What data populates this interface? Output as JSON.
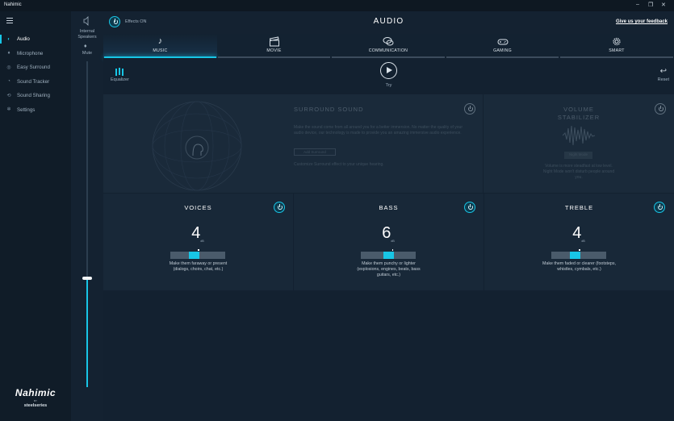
{
  "window": {
    "title": "Nahimic",
    "controls": [
      "–",
      "❐",
      "✕"
    ]
  },
  "sidebar": {
    "items": [
      {
        "label": "Audio",
        "icon": "audio-icon",
        "active": true
      },
      {
        "label": "Microphone",
        "icon": "microphone-icon",
        "active": false
      },
      {
        "label": "Easy Surround",
        "icon": "easy-surround-icon",
        "active": false
      },
      {
        "label": "Sound Tracker",
        "icon": "sound-tracker-icon",
        "active": false
      },
      {
        "label": "Sound Sharing",
        "icon": "sound-sharing-icon",
        "active": false
      },
      {
        "label": "Settings",
        "icon": "gear-icon",
        "active": false
      }
    ],
    "brand": {
      "name": "Nahimic",
      "by": "BY",
      "partner": "steelseries"
    }
  },
  "device": {
    "name": "Internal Speakers",
    "mute_label": "Mute",
    "volume_fraction": 0.34
  },
  "header": {
    "effects_label": "Effects ON",
    "title": "AUDIO",
    "feedback_link": "Give us your feedback"
  },
  "tabs": [
    {
      "label": "MUSIC",
      "icon": "music-note-icon",
      "active": true
    },
    {
      "label": "MOVIE",
      "icon": "clapperboard-icon",
      "active": false
    },
    {
      "label": "COMMUNICATION",
      "icon": "chat-bubbles-icon",
      "active": false
    },
    {
      "label": "GAMING",
      "icon": "gamepad-icon",
      "active": false
    },
    {
      "label": "SMART",
      "icon": "smart-gear-icon",
      "active": false
    }
  ],
  "controls": {
    "equalizer_label": "Equalizer",
    "try_label": "Try",
    "reset_label": "Reset"
  },
  "surround": {
    "title": "SURROUND SOUND",
    "description": "Make the sound come from all around you for a better immersion. No matter the quality of your audio device, our technology is made to provide you an amazing immersive audio experience.",
    "button_label": "Add Surround",
    "customize_text": "Customize Surround effect to your unique hearing.",
    "enabled": false
  },
  "stabilizer": {
    "title_line1": "VOLUME",
    "title_line2": "STABILIZER",
    "button_label": "Night Mode",
    "description": "Volume is more steadfast at low level. Night Mode won't disturb people around you.",
    "enabled": false
  },
  "bands": [
    {
      "title": "VOICES",
      "value": "4",
      "unit": "dB",
      "fraction": 0.4,
      "description_line1": "Make them faraway or present",
      "description_line2": "(dialogs, choirs, chat, etc.)",
      "description_line3": "",
      "enabled": true
    },
    {
      "title": "BASS",
      "value": "6",
      "unit": "dB",
      "fraction": 0.5,
      "description_line1": "Make them punchy or lighter",
      "description_line2": "(explosions, engines, beats, bass",
      "description_line3": "guitars, etc.)",
      "enabled": true
    },
    {
      "title": "TREBLE",
      "value": "4",
      "unit": "dB",
      "fraction": 0.4,
      "description_line1": "Make them faded or clearer (footsteps,",
      "description_line2": "whistles, cymbals, etc.)",
      "description_line3": "",
      "enabled": true
    }
  ],
  "colors": {
    "accent": "#18c6e6",
    "background": "#0f1a26",
    "panel": "#182838"
  }
}
